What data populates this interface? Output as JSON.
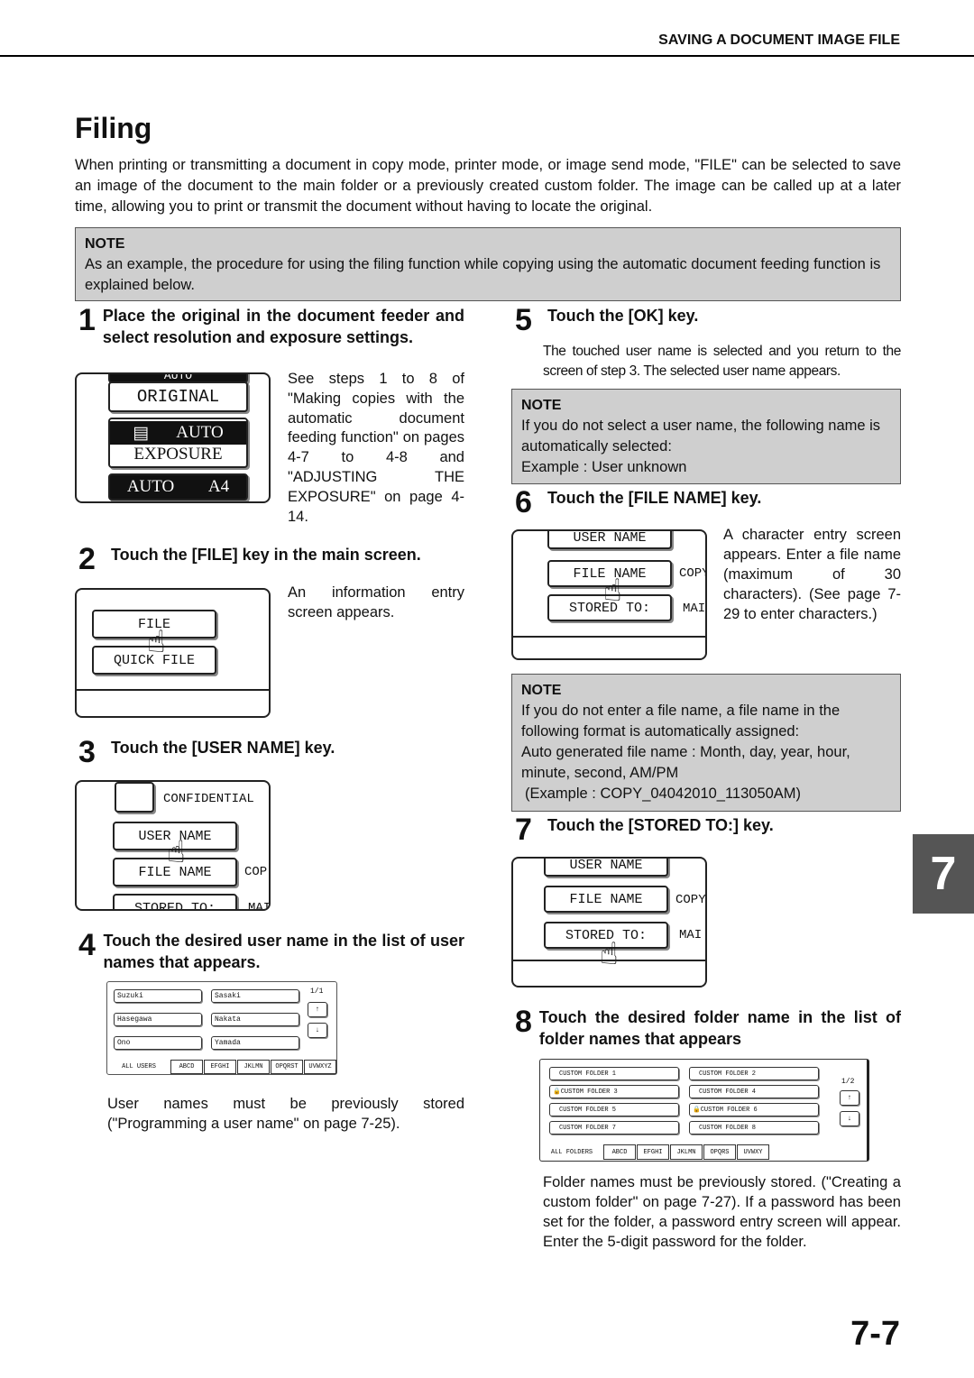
{
  "header": "SAVING A DOCUMENT IMAGE FILE",
  "title": "Filing",
  "intro": "When printing or transmitting a document in copy mode, printer mode, or image send mode, \"FILE\" can be selected to save an image of the document to the main folder or a previously created custom folder. The image can be called up at a later time, allowing you to print or transmit the document without having to locate the original.",
  "note1": {
    "label": "NOTE",
    "text": "As an example, the procedure for using the filing function while copying using the automatic document feeding function is explained below."
  },
  "steps": [
    {
      "num": "1",
      "title": "Place the original in the document feeder and select resolution and exposure settings.",
      "text": "See steps 1 to 8 of \"Making copies with the automatic document feeding function\" on pages 4-7 to 4-8 and \"ADJUSTING THE EXPOSURE\" on page 4-14.",
      "screen": {
        "top": "AUTO",
        "original": "ORIGINAL",
        "auto": "AUTO",
        "exposure": "EXPOSURE",
        "auto2": "AUTO",
        "paper": "A4"
      }
    },
    {
      "num": "2",
      "title": "Touch the [FILE] key in the main screen.",
      "text": "An information entry screen appears.",
      "screen": {
        "file": "FILE",
        "quick": "QUICK FILE"
      }
    },
    {
      "num": "3",
      "title": "Touch the [USER NAME] key.",
      "screen": {
        "confidential": "CONFIDENTIAL",
        "user": "USER NAME",
        "file": "FILE NAME",
        "copy": "COP",
        "stored": "STORED TO:",
        "main": "MAI"
      }
    },
    {
      "num": "4",
      "title": "Touch the desired user name in the list of user names that appears.",
      "text": "User names must be previously stored (\"Programming a user name\" on page 7-25).",
      "screen": {
        "names": [
          "Suzuki",
          "Sasaki",
          "Hasegawa",
          "Nakata",
          "Ono",
          "Yamada"
        ],
        "page": "1/1",
        "tabs": [
          "ALL USERS",
          "ABCD",
          "EFGHI",
          "JKLMN",
          "OPQRST",
          "UVWXYZ"
        ]
      }
    },
    {
      "num": "5",
      "title": "Touch the [OK] key.",
      "text": "The touched user name is selected and you return to the screen of step 3. The selected user name appears."
    },
    {
      "num": "6",
      "title": "Touch the [FILE NAME] key.",
      "text": "A character entry screen appears. Enter a file name (maximum of 30 characters). (See page 7-29 to enter characters.)",
      "screen": {
        "user": "USER NAME",
        "file": "FILE NAME",
        "copy": "COPY",
        "stored": "STORED TO:",
        "main": "MAI"
      }
    },
    {
      "num": "7",
      "title": "Touch the [STORED TO:] key.",
      "screen": {
        "user": "USER NAME",
        "file": "FILE NAME",
        "copy": "COPY",
        "stored": "STORED TO:",
        "main": "MAI"
      }
    },
    {
      "num": "8",
      "title": "Touch the desired folder name in the list of folder names that appears",
      "text": "Folder names must be previously stored. (\"Creating a custom folder\" on page 7-27). If a password has been set for the folder, a password entry screen will appear. Enter the 5-digit password for the folder.",
      "screen": {
        "folders": [
          "CUSTOM FOLDER 1",
          "CUSTOM FOLDER 2",
          "CUSTOM FOLDER 3",
          "CUSTOM FOLDER 4",
          "CUSTOM FOLDER 5",
          "CUSTOM FOLDER 6",
          "CUSTOM FOLDER 7",
          "CUSTOM FOLDER 8"
        ],
        "locked": [
          false,
          false,
          true,
          false,
          false,
          true,
          false,
          false
        ],
        "page": "1/2",
        "tabs": [
          "ALL FOLDERS",
          "ABCD",
          "EFGHI",
          "JKLMN",
          "OPQRS",
          "UVWXY"
        ]
      }
    }
  ],
  "note2": {
    "label": "NOTE",
    "lines": [
      "If you do not select a user name, the following name is automatically selected:",
      "Example : User unknown"
    ]
  },
  "note3": {
    "label": "NOTE",
    "lines": [
      "If you do not enter a file name, a file name in the following format is automatically assigned:",
      "Auto generated file name : Month, day, year, hour, minute, second, AM/PM",
      "(Example : COPY_04042010_113050AM)"
    ]
  },
  "chapter_tab": "7",
  "page_number": "7-7"
}
